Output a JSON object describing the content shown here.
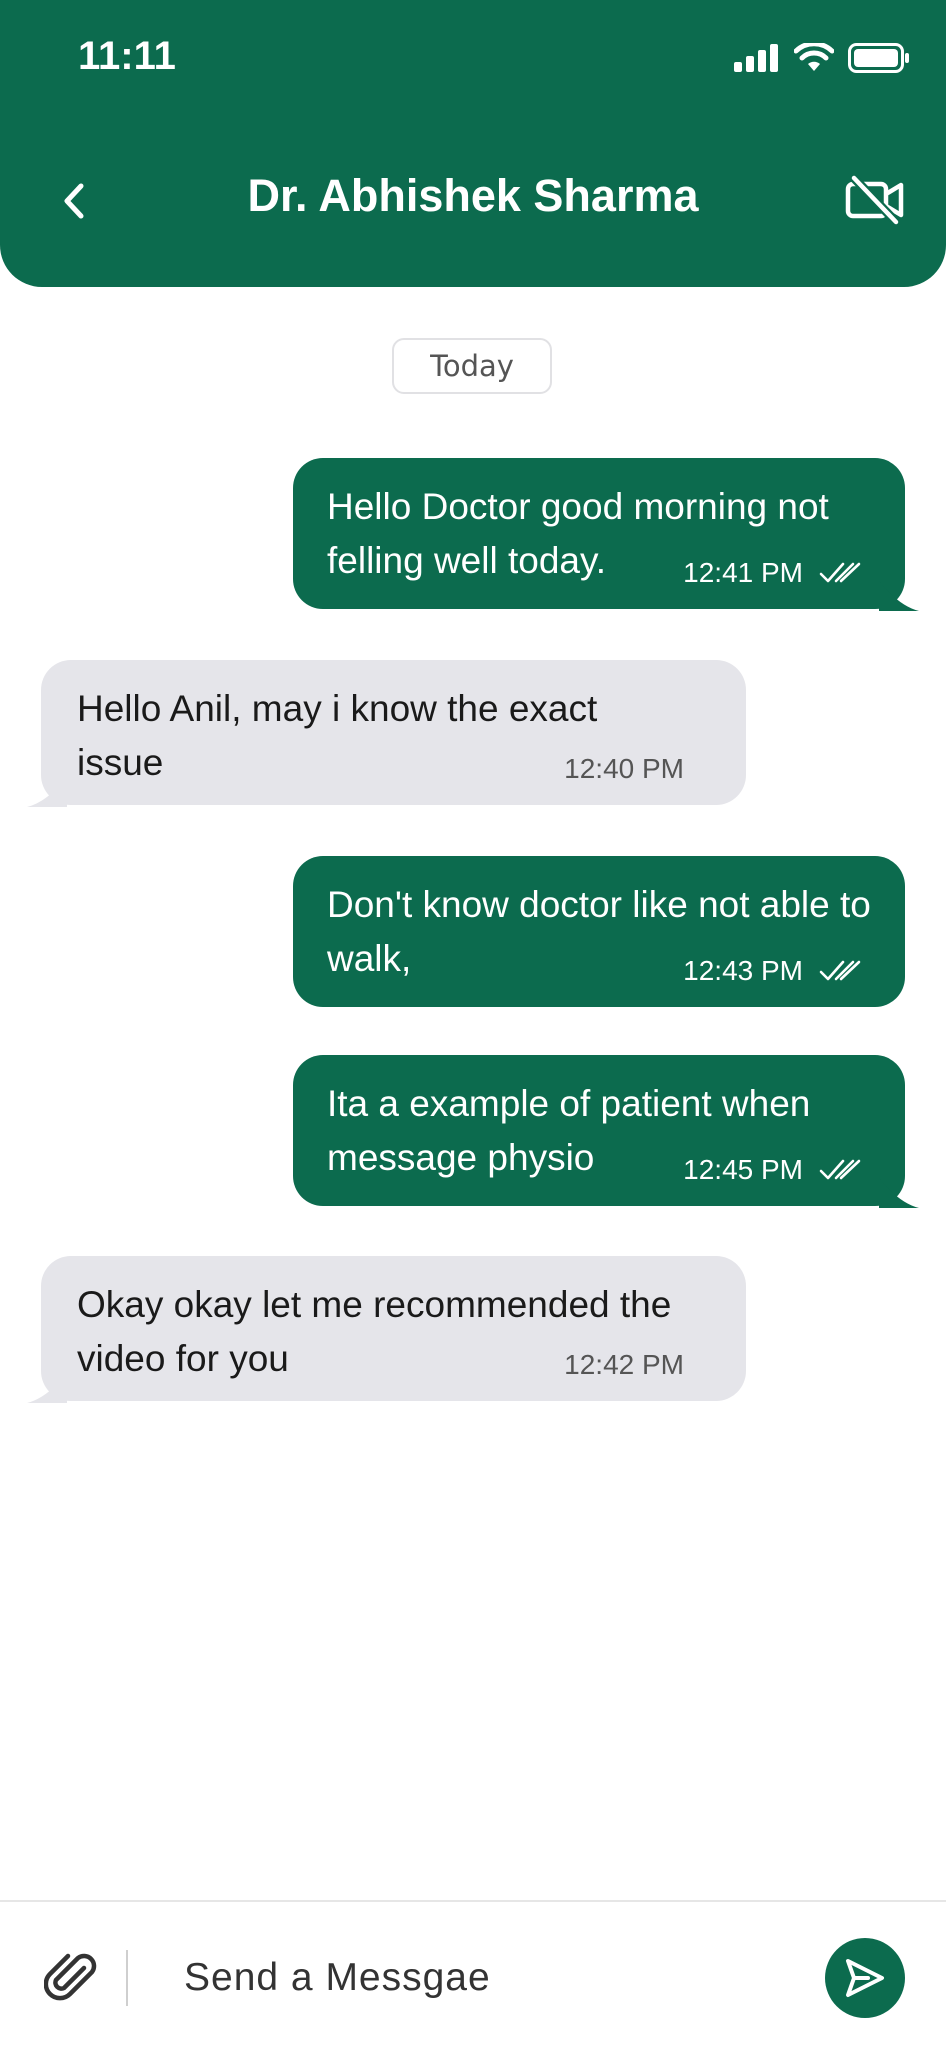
{
  "status_bar": {
    "time": "11:11"
  },
  "header": {
    "title": "Dr. Abhishek Sharma"
  },
  "chat": {
    "date_label": "Today",
    "messages": [
      {
        "direction": "out",
        "text": "Hello Doctor good morning not felling well today.",
        "time": "12:41 PM",
        "read": true
      },
      {
        "direction": "in",
        "text": "Hello Anil, may i know the exact issue",
        "time": "12:40 PM"
      },
      {
        "direction": "out",
        "text": "Don't know doctor like not able to walk,",
        "time": "12:43 PM",
        "read": true
      },
      {
        "direction": "out",
        "text": "Ita a example of patient when message physio",
        "time": "12:45 PM",
        "read": true
      },
      {
        "direction": "in",
        "text": "Okay okay let me recommended the video for you",
        "time": "12:42 PM"
      }
    ]
  },
  "composer": {
    "placeholder": "Send a Messgae",
    "value": ""
  },
  "colors": {
    "brand": "#0c6b4e",
    "incoming_bubble": "#e5e5ea",
    "background": "#ffffff"
  },
  "icons": {
    "back": "chevron-left-icon",
    "video": "video-off-icon",
    "read": "double-check-icon",
    "attach": "paperclip-icon",
    "send": "send-icon"
  }
}
